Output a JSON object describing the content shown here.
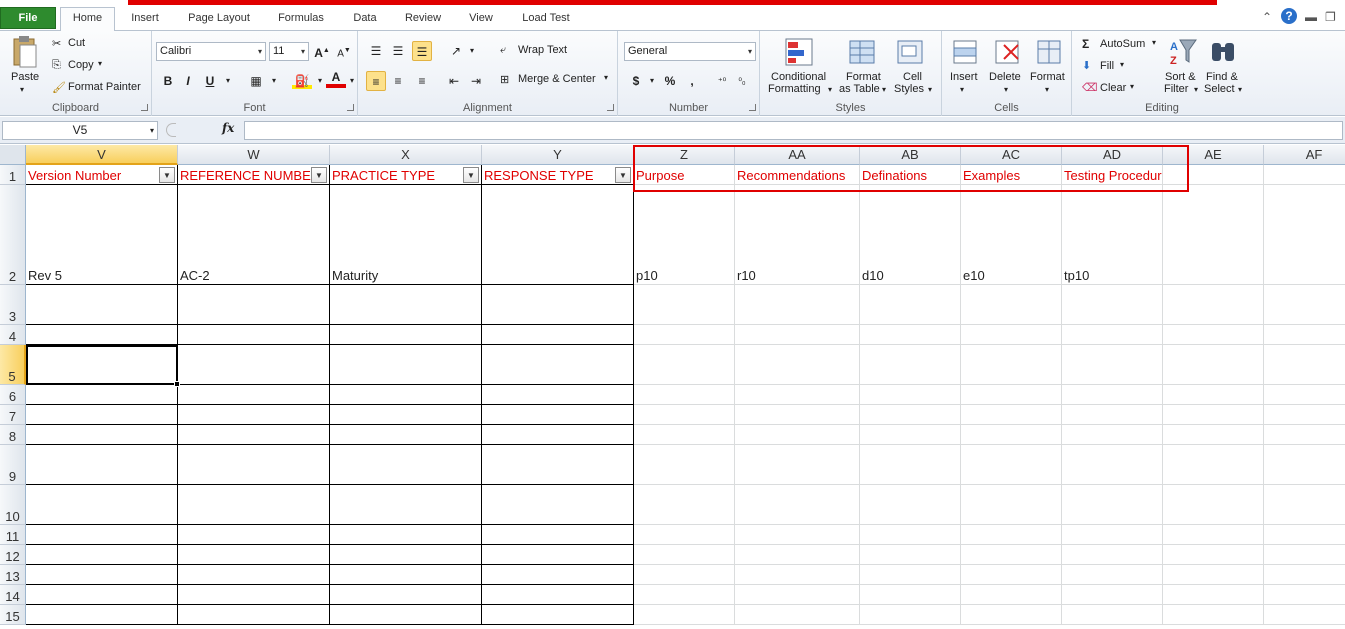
{
  "ribbon_tabs": [
    "File",
    "Home",
    "Insert",
    "Page Layout",
    "Formulas",
    "Data",
    "Review",
    "View",
    "Load Test"
  ],
  "clipboard": {
    "paste": "Paste",
    "cut": "Cut",
    "copy": "Copy",
    "format_painter": "Format Painter",
    "label": "Clipboard"
  },
  "font": {
    "name": "Calibri",
    "size": "11",
    "bold": "B",
    "italic": "I",
    "underline": "U",
    "label": "Font"
  },
  "alignment": {
    "wrap_text": "Wrap Text",
    "merge_center": "Merge & Center",
    "label": "Alignment"
  },
  "number": {
    "format": "General",
    "currency": "$",
    "percent": "%",
    "comma": ",",
    "label": "Number"
  },
  "styles": {
    "conditional_1": "Conditional",
    "conditional_2": "Formatting",
    "format_table_1": "Format",
    "format_table_2": "as Table",
    "cell_styles_1": "Cell",
    "cell_styles_2": "Styles",
    "label": "Styles"
  },
  "cells": {
    "insert": "Insert",
    "delete": "Delete",
    "format": "Format",
    "label": "Cells"
  },
  "editing": {
    "autosum": "AutoSum",
    "fill": "Fill",
    "clear": "Clear",
    "sort_1": "Sort &",
    "sort_2": "Filter",
    "find_1": "Find &",
    "find_2": "Select",
    "label": "Editing"
  },
  "formula_bar": {
    "name_box": "V5",
    "fx": "fx",
    "formula": ""
  },
  "columns": [
    "V",
    "W",
    "X",
    "Y",
    "Z",
    "AA",
    "AB",
    "AC",
    "AD",
    "AE",
    "AF"
  ],
  "rows": [
    "1",
    "2",
    "3",
    "4",
    "5",
    "6",
    "7",
    "8",
    "9",
    "10",
    "11",
    "12",
    "13",
    "14",
    "15"
  ],
  "headers": [
    "Version Number",
    "REFERENCE NUMBER",
    "PRACTICE TYPE",
    "RESPONSE TYPE",
    "Purpose",
    "Recommendations",
    "Definations",
    "Examples",
    "Testing Procedures",
    "",
    ""
  ],
  "row2": [
    "Rev 5",
    "AC-2",
    "Maturity",
    "",
    "p10",
    "r10",
    "d10",
    "e10",
    "tp10",
    "",
    ""
  ],
  "colors": {
    "header_red": "#e00000",
    "annotation_red": "#e00000",
    "file_tab": "#2e8b2e",
    "selection": "#000000"
  }
}
